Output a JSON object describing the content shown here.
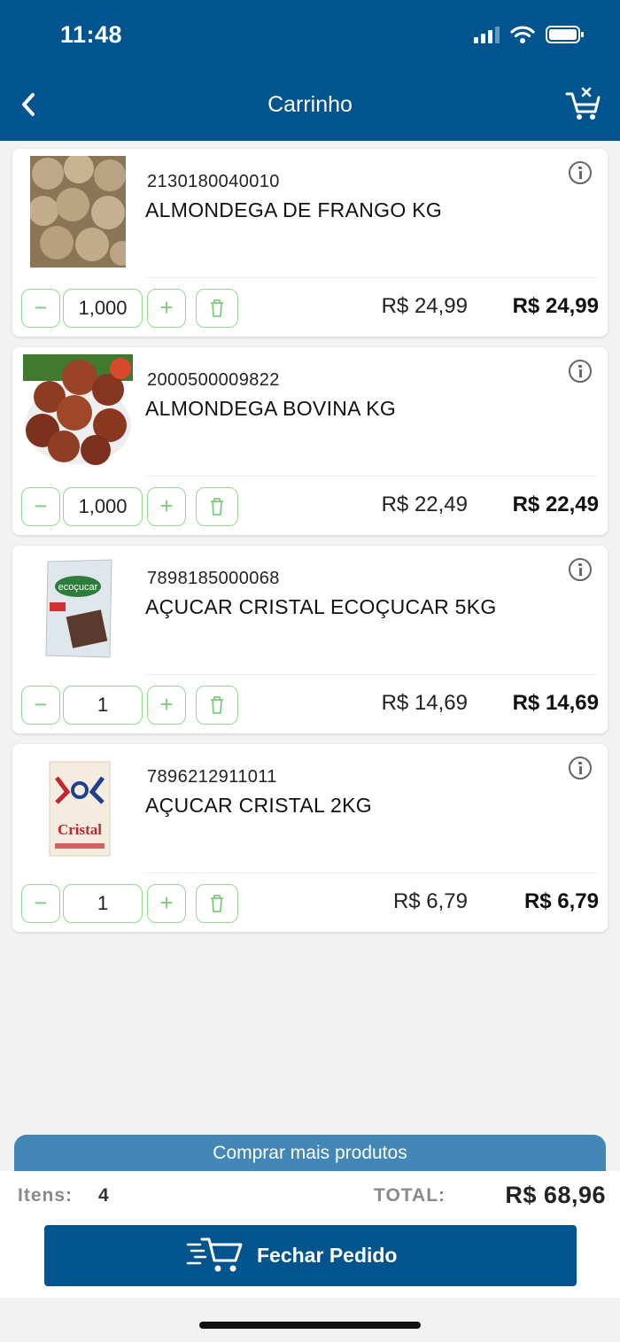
{
  "status_bar": {
    "time": "11:48"
  },
  "header": {
    "title": "Carrinho"
  },
  "icons": {
    "back": "chevron-left-icon",
    "clear_cart": "cart-clear-icon",
    "info": "info-icon",
    "minus": "minus-icon",
    "plus": "plus-icon",
    "delete": "trash-icon",
    "checkout": "fast-cart-icon"
  },
  "colors": {
    "header_bg": "#02548f",
    "accent_green": "#8fd98f",
    "secondary_button": "#4287b5"
  },
  "cart": {
    "items": [
      {
        "code": "2130180040010",
        "name": "ALMONDEGA DE FRANGO  KG",
        "quantity": "1,000",
        "unit_price": "R$ 24,99",
        "total": "R$ 24,99"
      },
      {
        "code": "2000500009822",
        "name": "ALMONDEGA BOVINA KG",
        "quantity": "1,000",
        "unit_price": "R$ 22,49",
        "total": "R$ 22,49"
      },
      {
        "code": "7898185000068",
        "name": "AÇUCAR CRISTAL ECOÇUCAR 5KG",
        "quantity": "1",
        "unit_price": "R$ 14,69",
        "total": "R$ 14,69"
      },
      {
        "code": "7896212911011",
        "name": "AÇUCAR CRISTAL 2KG",
        "quantity": "1",
        "unit_price": "R$ 6,79",
        "total": "R$ 6,79"
      }
    ],
    "buttons": {
      "minus": "−",
      "plus": "+"
    }
  },
  "footer": {
    "more_products": "Comprar mais produtos",
    "items_label": "Itens:",
    "items_count": "4",
    "total_label": "TOTAL:",
    "total_value": "R$ 68,96",
    "checkout": "Fechar Pedido"
  }
}
